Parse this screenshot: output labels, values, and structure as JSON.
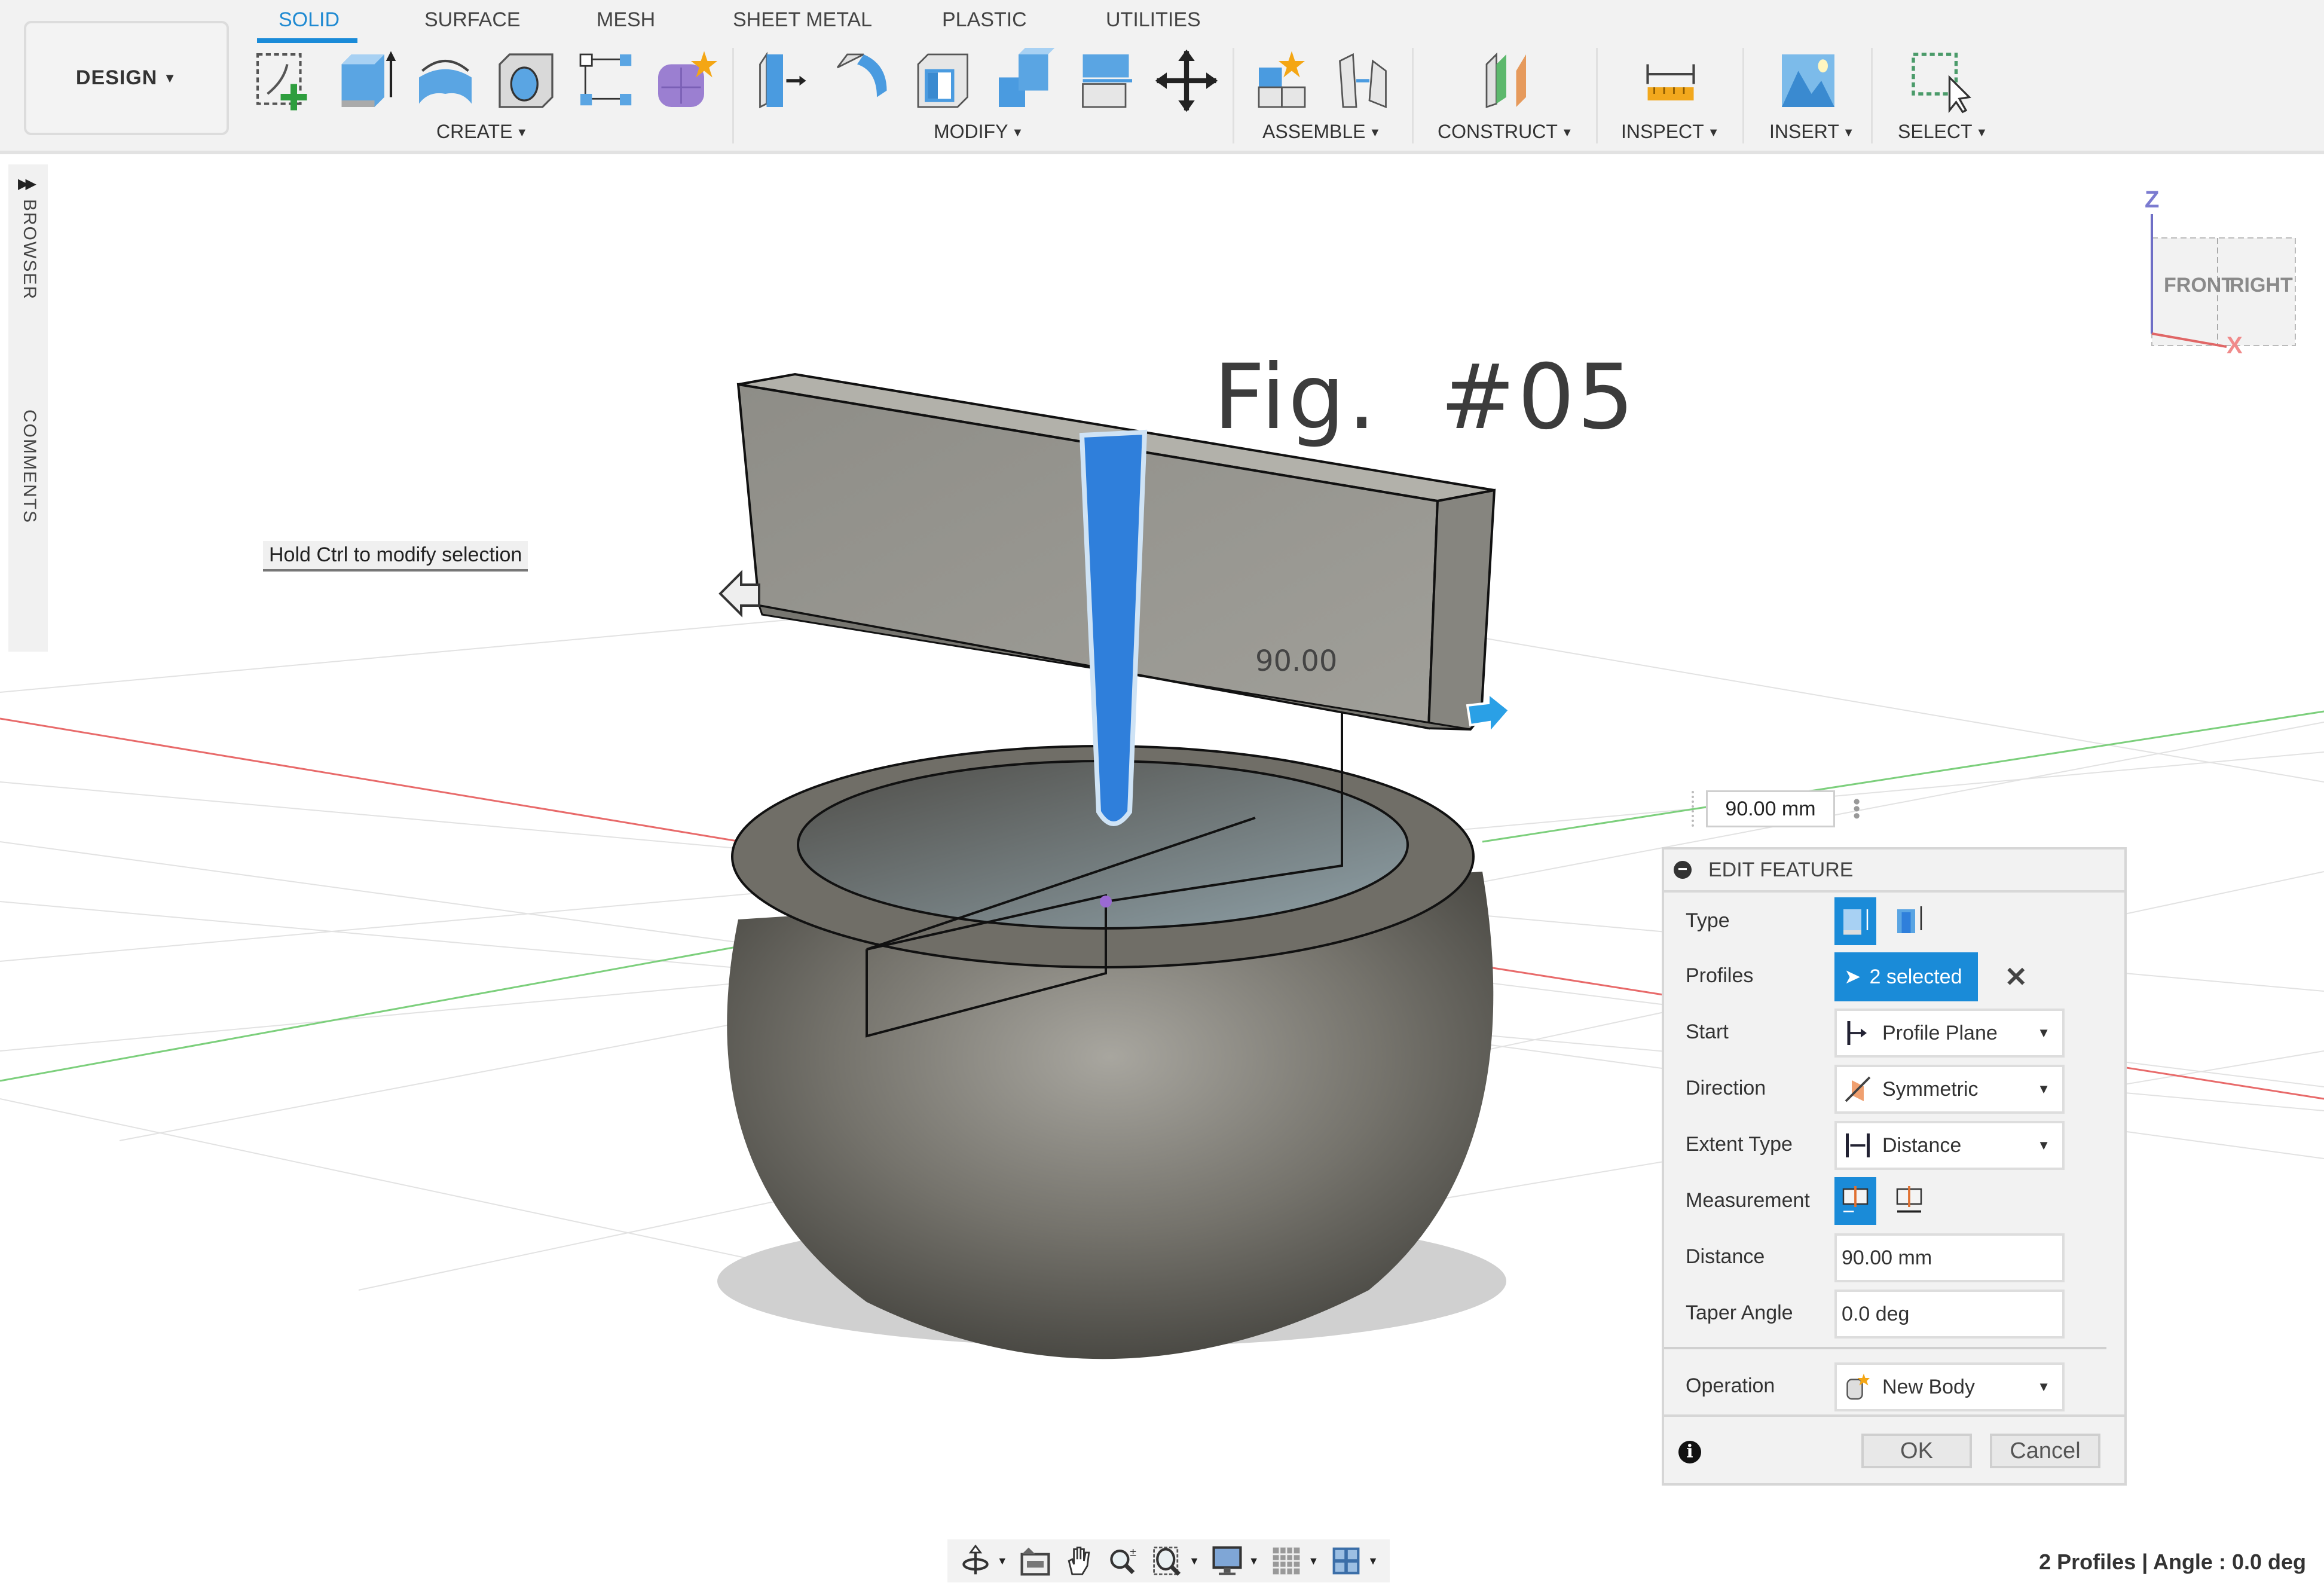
{
  "workspace": {
    "label": "DESIGN",
    "icon": "caret-down-icon"
  },
  "tabs": [
    {
      "label": "SOLID",
      "active": true
    },
    {
      "label": "SURFACE",
      "active": false
    },
    {
      "label": "MESH",
      "active": false
    },
    {
      "label": "SHEET METAL",
      "active": false
    },
    {
      "label": "PLASTIC",
      "active": false
    },
    {
      "label": "UTILITIES",
      "active": false
    }
  ],
  "groups": [
    {
      "label": "CREATE",
      "tools": [
        "create-sketch-icon",
        "extrude-icon",
        "revolve-icon",
        "hole-icon",
        "rectangular-pattern-icon",
        "create-form-icon"
      ]
    },
    {
      "label": "MODIFY",
      "tools": [
        "press-pull-icon",
        "fillet-icon",
        "shell-icon",
        "combine-icon",
        "offset-face-icon",
        "move-copy-icon"
      ]
    },
    {
      "label": "ASSEMBLE",
      "tools": [
        "new-component-icon",
        "joint-icon"
      ]
    },
    {
      "label": "CONSTRUCT",
      "tools": [
        "offset-plane-icon"
      ]
    },
    {
      "label": "INSPECT",
      "tools": [
        "measure-icon"
      ]
    },
    {
      "label": "INSERT",
      "tools": [
        "insert-image-icon"
      ]
    },
    {
      "label": "SELECT",
      "tools": [
        "window-select-icon"
      ]
    }
  ],
  "sidepanel": {
    "browser": "BROWSER",
    "comments": "COMMENTS"
  },
  "viewport": {
    "figure_title": "Fig.  #05",
    "tooltip": "Hold Ctrl to modify selection",
    "dimension_label": "90.00",
    "distance_manipulator": "90.00 mm"
  },
  "viewcube": {
    "front": "FRONT",
    "right": "RIGHT",
    "z_axis": "Z",
    "x_axis": "X"
  },
  "edit_feature": {
    "title": "EDIT FEATURE",
    "rows": {
      "type": {
        "label": "Type",
        "options": [
          "solid-extrude-icon",
          "thin-extrude-icon"
        ],
        "selected": 0
      },
      "profiles": {
        "label": "Profiles",
        "value": "2 selected"
      },
      "start": {
        "label": "Start",
        "value": "Profile Plane"
      },
      "direction": {
        "label": "Direction",
        "value": "Symmetric"
      },
      "extent_type": {
        "label": "Extent Type",
        "value": "Distance"
      },
      "measurement": {
        "label": "Measurement",
        "options": [
          "half-length-icon",
          "whole-length-icon"
        ],
        "selected": 0
      },
      "distance": {
        "label": "Distance",
        "value": "90.00 mm"
      },
      "taper_angle": {
        "label": "Taper Angle",
        "value": "0.0 deg"
      },
      "operation": {
        "label": "Operation",
        "value": "New Body"
      }
    },
    "ok": "OK",
    "cancel": "Cancel"
  },
  "navbar": [
    "orbit-icon",
    "look-at-icon",
    "pan-icon",
    "zoom-icon",
    "fit-icon",
    "display-settings-icon",
    "grid-settings-icon",
    "viewports-icon"
  ],
  "status": "2 Profiles | Angle : 0.0 deg",
  "colors": {
    "accent": "#1a8bd8",
    "selection": "#2f7fdb",
    "body": "#8f8e88",
    "x_axis": "#e06666",
    "y_axis": "#6cc06c",
    "z_axis": "#6f6fc6"
  }
}
